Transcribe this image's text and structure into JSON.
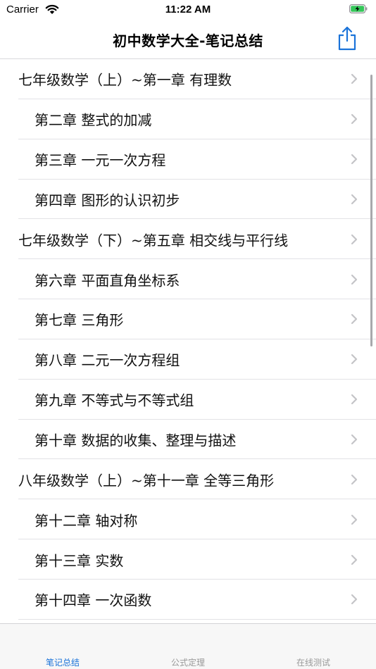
{
  "status_bar": {
    "carrier": "Carrier",
    "time": "11:22 AM"
  },
  "nav": {
    "title": "初中数学大全-笔记总结",
    "share_icon": "share-icon"
  },
  "list": {
    "items": [
      {
        "label": "七年级数学（上）~第一章 有理数",
        "level": "main"
      },
      {
        "label": "第二章 整式的加减",
        "level": "sub"
      },
      {
        "label": "第三章 一元一次方程",
        "level": "sub"
      },
      {
        "label": "第四章 图形的认识初步",
        "level": "sub"
      },
      {
        "label": "七年级数学（下）~第五章 相交线与平行线",
        "level": "main"
      },
      {
        "label": "第六章  平面直角坐标系",
        "level": "sub"
      },
      {
        "label": "第七章  三角形",
        "level": "sub"
      },
      {
        "label": "第八章  二元一次方程组",
        "level": "sub"
      },
      {
        "label": "第九章  不等式与不等式组",
        "level": "sub"
      },
      {
        "label": "第十章  数据的收集、整理与描述",
        "level": "sub"
      },
      {
        "label": "八年级数学（上）~第十一章  全等三角形",
        "level": "main"
      },
      {
        "label": "第十二章  轴对称",
        "level": "sub"
      },
      {
        "label": "第十三章  实数",
        "level": "sub"
      },
      {
        "label": "第十四章  一次函数",
        "level": "sub"
      }
    ]
  },
  "tabs": [
    {
      "label": "笔记总结",
      "active": true
    },
    {
      "label": "公式定理",
      "active": false
    },
    {
      "label": "在线测试",
      "active": false
    }
  ],
  "colors": {
    "accent": "#1a73d9",
    "tab_inactive": "#999999",
    "chevron": "#c4c4c7",
    "separator": "#e2e2e6"
  }
}
